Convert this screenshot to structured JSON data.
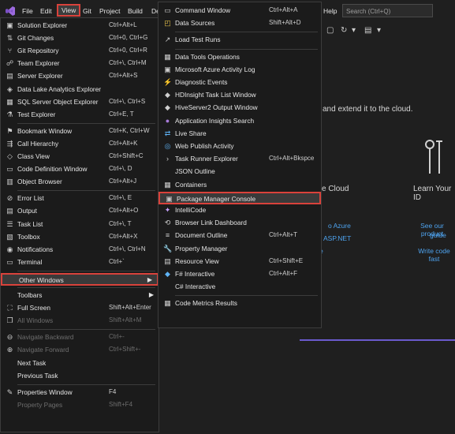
{
  "menubar": {
    "items": [
      "File",
      "Edit",
      "View",
      "Git",
      "Project",
      "Build",
      "De",
      "Help"
    ],
    "search_placeholder": "Search (Ctrl+Q)"
  },
  "background": {
    "headline": "and extend it to the cloud.",
    "cloud_label": "e Cloud",
    "learn_label": "Learn Your ID",
    "links": [
      "o Azure",
      "ASP.NET",
      "e",
      "See our product",
      "guide",
      "Write code fast"
    ]
  },
  "view_menu": [
    {
      "icon": "solution-explorer",
      "label": "Solution Explorer",
      "shortcut": "Ctrl+Alt+L"
    },
    {
      "icon": "git-changes",
      "label": "Git Changes",
      "shortcut": "Ctrl+0, Ctrl+G"
    },
    {
      "icon": "git-repository",
      "label": "Git Repository",
      "shortcut": "Ctrl+0, Ctrl+R"
    },
    {
      "icon": "team-explorer",
      "label": "Team Explorer",
      "shortcut": "Ctrl+\\, Ctrl+M"
    },
    {
      "icon": "server-explorer",
      "label": "Server Explorer",
      "shortcut": "Ctrl+Alt+S"
    },
    {
      "icon": "data-lake",
      "label": "Data Lake Analytics Explorer",
      "shortcut": ""
    },
    {
      "icon": "sql-server",
      "label": "SQL Server Object Explorer",
      "shortcut": "Ctrl+\\, Ctrl+S"
    },
    {
      "icon": "test-explorer",
      "label": "Test Explorer",
      "shortcut": "Ctrl+E, T"
    },
    {
      "sep": true
    },
    {
      "icon": "bookmark",
      "label": "Bookmark Window",
      "shortcut": "Ctrl+K, Ctrl+W"
    },
    {
      "icon": "call-hierarchy",
      "label": "Call Hierarchy",
      "shortcut": "Ctrl+Alt+K"
    },
    {
      "icon": "class-view",
      "label": "Class View",
      "shortcut": "Ctrl+Shift+C"
    },
    {
      "icon": "code-definition",
      "label": "Code Definition Window",
      "shortcut": "Ctrl+\\, D"
    },
    {
      "icon": "object-browser",
      "label": "Object Browser",
      "shortcut": "Ctrl+Alt+J"
    },
    {
      "sep": true
    },
    {
      "icon": "error-list",
      "label": "Error List",
      "shortcut": "Ctrl+\\, E"
    },
    {
      "icon": "output",
      "label": "Output",
      "shortcut": "Ctrl+Alt+O"
    },
    {
      "icon": "task-list",
      "label": "Task List",
      "shortcut": "Ctrl+\\, T"
    },
    {
      "icon": "toolbox",
      "label": "Toolbox",
      "shortcut": "Ctrl+Alt+X"
    },
    {
      "icon": "notifications",
      "label": "Notifications",
      "shortcut": "Ctrl+\\, Ctrl+N"
    },
    {
      "icon": "terminal",
      "label": "Terminal",
      "shortcut": "Ctrl+`"
    },
    {
      "sep": true
    },
    {
      "icon": "",
      "label": "Other Windows",
      "shortcut": "",
      "submenu": true,
      "highlight": true
    },
    {
      "sep": true
    },
    {
      "icon": "",
      "label": "Toolbars",
      "shortcut": "",
      "submenu": true
    },
    {
      "icon": "full-screen",
      "label": "Full Screen",
      "shortcut": "Shift+Alt+Enter"
    },
    {
      "icon": "all-windows",
      "label": "All Windows",
      "shortcut": "Shift+Alt+M",
      "disabled": true
    },
    {
      "sep": true
    },
    {
      "icon": "navigate-back",
      "label": "Navigate Backward",
      "shortcut": "Ctrl+-",
      "disabled": true
    },
    {
      "icon": "navigate-forward",
      "label": "Navigate Forward",
      "shortcut": "Ctrl+Shift+-",
      "disabled": true
    },
    {
      "icon": "",
      "label": "Next Task",
      "shortcut": ""
    },
    {
      "icon": "",
      "label": "Previous Task",
      "shortcut": ""
    },
    {
      "sep": true
    },
    {
      "icon": "properties",
      "label": "Properties Window",
      "shortcut": "F4"
    },
    {
      "icon": "",
      "label": "Property Pages",
      "shortcut": "Shift+F4",
      "disabled": true
    }
  ],
  "other_windows_menu": [
    {
      "icon": "command-window",
      "label": "Command Window",
      "shortcut": "Ctrl+Alt+A"
    },
    {
      "icon": "data-sources",
      "label": "Data Sources",
      "shortcut": "Shift+Alt+D"
    },
    {
      "sep": true
    },
    {
      "icon": "load-test",
      "label": "Load Test Runs",
      "shortcut": ""
    },
    {
      "sep": true
    },
    {
      "icon": "data-tools",
      "label": "Data Tools Operations",
      "shortcut": ""
    },
    {
      "icon": "azure-activity",
      "label": "Microsoft Azure Activity Log",
      "shortcut": ""
    },
    {
      "icon": "diagnostic",
      "label": "Diagnostic Events",
      "shortcut": ""
    },
    {
      "icon": "hdinsight",
      "label": "HDInsight Task List Window",
      "shortcut": ""
    },
    {
      "icon": "hiveserver",
      "label": "HiveServer2 Output Window",
      "shortcut": ""
    },
    {
      "icon": "app-insights",
      "label": "Application Insights Search",
      "shortcut": ""
    },
    {
      "icon": "live-share",
      "label": "Live Share",
      "shortcut": ""
    },
    {
      "icon": "web-publish",
      "label": "Web Publish Activity",
      "shortcut": ""
    },
    {
      "icon": "task-runner",
      "label": "Task Runner Explorer",
      "shortcut": "Ctrl+Alt+Bkspce"
    },
    {
      "icon": "",
      "label": "JSON Outline",
      "shortcut": ""
    },
    {
      "icon": "containers",
      "label": "Containers",
      "shortcut": ""
    },
    {
      "icon": "package-manager",
      "label": "Package Manager Console",
      "shortcut": "",
      "highlight": true
    },
    {
      "icon": "intellicode",
      "label": "IntelliCode",
      "shortcut": ""
    },
    {
      "icon": "browser-link",
      "label": "Browser Link Dashboard",
      "shortcut": ""
    },
    {
      "icon": "document-outline",
      "label": "Document Outline",
      "shortcut": "Ctrl+Alt+T"
    },
    {
      "icon": "property-manager",
      "label": "Property Manager",
      "shortcut": ""
    },
    {
      "icon": "resource-view",
      "label": "Resource View",
      "shortcut": "Ctrl+Shift+E"
    },
    {
      "icon": "fsharp",
      "label": "F# Interactive",
      "shortcut": "Ctrl+Alt+F"
    },
    {
      "icon": "",
      "label": "C# Interactive",
      "shortcut": ""
    },
    {
      "sep": true
    },
    {
      "icon": "code-metrics",
      "label": "Code Metrics Results",
      "shortcut": ""
    }
  ],
  "colors": {
    "highlight_border": "#d9423b",
    "link": "#4ea3ef",
    "accent": "#6a5acd"
  }
}
